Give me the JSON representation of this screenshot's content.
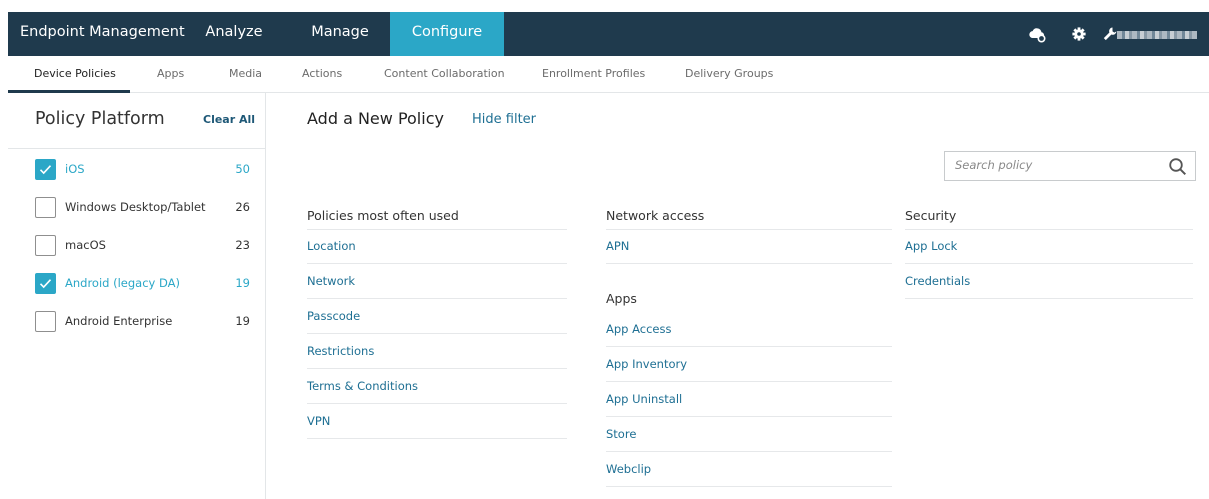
{
  "topbar": {
    "brand": "Endpoint Management",
    "tabs": [
      {
        "label": "Analyze"
      },
      {
        "label": "Manage"
      },
      {
        "label": "Configure",
        "active": true
      }
    ],
    "icons": [
      "cloud-gear-icon",
      "gear-icon",
      "wrench-icon"
    ],
    "colors": {
      "bar": "#1f3a4d",
      "active_tab": "#2ba7c7"
    }
  },
  "subnav": {
    "tabs": [
      {
        "label": "Device Policies",
        "active": true
      },
      {
        "label": "Apps"
      },
      {
        "label": "Media"
      },
      {
        "label": "Actions"
      },
      {
        "label": "Content Collaboration"
      },
      {
        "label": "Enrollment Profiles"
      },
      {
        "label": "Delivery Groups"
      }
    ]
  },
  "filter": {
    "title": "Policy Platform",
    "clear_all": "Clear All",
    "platforms": [
      {
        "label": "iOS",
        "count": "50",
        "checked": true
      },
      {
        "label": "Windows Desktop/Tablet",
        "count": "26",
        "checked": false
      },
      {
        "label": "macOS",
        "count": "23",
        "checked": false
      },
      {
        "label": "Android (legacy DA)",
        "count": "19",
        "checked": true
      },
      {
        "label": "Android Enterprise",
        "count": "19",
        "checked": false
      }
    ]
  },
  "main": {
    "title": "Add a New Policy",
    "hide_filter": "Hide filter",
    "search": {
      "placeholder": "Search policy",
      "value": ""
    },
    "columns": {
      "most_used": {
        "heading": "Policies most often used",
        "items": [
          "Location",
          "Network",
          "Passcode",
          "Restrictions",
          "Terms & Conditions",
          "VPN"
        ]
      },
      "network": {
        "heading": "Network access",
        "items": [
          "APN"
        ]
      },
      "apps": {
        "heading": "Apps",
        "items": [
          "App Access",
          "App Inventory",
          "App Uninstall",
          "Store",
          "Webclip"
        ]
      },
      "security": {
        "heading": "Security",
        "items": [
          "App Lock",
          "Credentials"
        ]
      }
    }
  }
}
